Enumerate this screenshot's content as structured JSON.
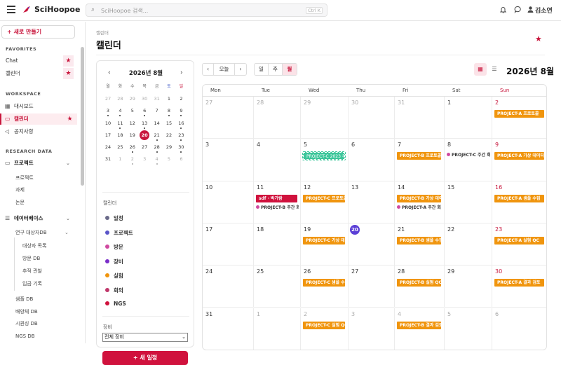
{
  "topbar": {
    "brand": "SciHoopoe",
    "search_placeholder": "SciHoopoe 검색...",
    "search_shortcut": "Ctrl K",
    "user_name": "김소연"
  },
  "sidebar": {
    "new_button": "+ 새로 만들기",
    "favorites_header": "FAVORITES",
    "favorites": [
      {
        "label": "Chat"
      },
      {
        "label": "캘린더"
      }
    ],
    "workspace_header": "WORKSPACE",
    "workspace": [
      {
        "label": "대시보드"
      },
      {
        "label": "캘린더"
      },
      {
        "label": "공지사항"
      }
    ],
    "research_header": "RESEARCH DATA",
    "project_group": "프로젝트",
    "project_items": [
      {
        "label": "프로젝트"
      },
      {
        "label": "과제"
      },
      {
        "label": "논문"
      }
    ],
    "db_group": "데이터베이스",
    "db_sub_group": "연구 대상자DB",
    "db_sub_items": [
      {
        "label": "대상자 목록"
      },
      {
        "label": "방문 DB"
      },
      {
        "label": "추적 관찰"
      },
      {
        "label": "입금 기록"
      }
    ],
    "db_items": [
      {
        "label": "샘플 DB"
      },
      {
        "label": "배양체 DB"
      },
      {
        "label": "시퀀싱 DB"
      },
      {
        "label": "NGS DB"
      }
    ]
  },
  "page": {
    "breadcrumb": "캘린더",
    "title": "캘린더"
  },
  "mini_calendar": {
    "title": "2026년 8월",
    "weekdays": [
      "월",
      "화",
      "수",
      "목",
      "금",
      "토",
      "일"
    ],
    "weeks": [
      [
        "27",
        "28",
        "29",
        "30",
        "31",
        "1",
        "2"
      ],
      [
        "3",
        "4",
        "5",
        "6",
        "7",
        "8",
        "9"
      ],
      [
        "10",
        "11",
        "12",
        "13",
        "14",
        "15",
        "16"
      ],
      [
        "17",
        "18",
        "19",
        "20",
        "21",
        "22",
        "23"
      ],
      [
        "24",
        "25",
        "26",
        "27",
        "28",
        "29",
        "30"
      ],
      [
        "31",
        "1",
        "2",
        "3",
        "4",
        "5",
        "6"
      ]
    ]
  },
  "calendars": {
    "label": "캘린더",
    "items": [
      {
        "label": "일정",
        "color": "#6b6b8a"
      },
      {
        "label": "프로젝트",
        "color": "#5a55c8"
      },
      {
        "label": "방문",
        "color": "#d04aa0"
      },
      {
        "label": "장비",
        "color": "#7a2ec9"
      },
      {
        "label": "실험",
        "color": "#f0950e"
      },
      {
        "label": "회의",
        "color": "#c0386b"
      },
      {
        "label": "NGS",
        "color": "#d0123d"
      }
    ]
  },
  "equipment": {
    "label": "장비",
    "selected": "전체 장비"
  },
  "new_event_button": "+ 새 일정",
  "toolbar": {
    "prev": "‹",
    "today": "오늘",
    "next": "›",
    "views": [
      "일",
      "주",
      "월"
    ],
    "title": "2026년 8월"
  },
  "month": {
    "weekdays": [
      "Mon",
      "Tue",
      "Wed",
      "Thu",
      "Fri",
      "Sat",
      "Sun"
    ],
    "weeks": [
      [
        {
          "d": "27"
        },
        {
          "d": "28"
        },
        {
          "d": "29"
        },
        {
          "d": "30"
        },
        {
          "d": "31"
        },
        {
          "d": "1"
        },
        {
          "d": "2",
          "events": [
            {
              "t": "PROJECT-A 프로토콜",
              "k": "orange"
            }
          ]
        }
      ],
      [
        {
          "d": "3"
        },
        {
          "d": "4"
        },
        {
          "d": "5",
          "events": [
            {
              "t": "PROJECT-C 2023 주간",
              "k": "dash"
            }
          ]
        },
        {
          "d": "6"
        },
        {
          "d": "7",
          "events": [
            {
              "t": "PROJECT-B 프로토콜",
              "k": "orange"
            }
          ]
        },
        {
          "d": "8",
          "events": [
            {
              "t": "PROJECT-C 주간 회",
              "k": "dot"
            }
          ]
        },
        {
          "d": "9",
          "events": [
            {
              "t": "PROJECT-A 가상 데이터",
              "k": "orange"
            }
          ]
        }
      ],
      [
        {
          "d": "10"
        },
        {
          "d": "11",
          "events": [
            {
              "t": "sdf · 박가람",
              "k": "red"
            },
            {
              "t": "PROJECT-B 주간 회",
              "k": "dot"
            }
          ]
        },
        {
          "d": "12",
          "events": [
            {
              "t": "PROJECT-C 프로토콜",
              "k": "orange"
            }
          ]
        },
        {
          "d": "13"
        },
        {
          "d": "14",
          "events": [
            {
              "t": "PROJECT-B 가상 데이터",
              "k": "orange"
            },
            {
              "t": "PROJECT-A 주간 회",
              "k": "dot"
            }
          ]
        },
        {
          "d": "15"
        },
        {
          "d": "16",
          "events": [
            {
              "t": "PROJECT-A 샘플 수집",
              "k": "orange"
            }
          ]
        }
      ],
      [
        {
          "d": "17"
        },
        {
          "d": "18"
        },
        {
          "d": "19",
          "events": [
            {
              "t": "PROJECT-C 가상 데이터",
              "k": "orange"
            }
          ]
        },
        {
          "d": "20"
        },
        {
          "d": "21",
          "events": [
            {
              "t": "PROJECT-B 샘플 수집",
              "k": "orange"
            }
          ]
        },
        {
          "d": "22"
        },
        {
          "d": "23",
          "events": [
            {
              "t": "PROJECT-A 실험 QC",
              "k": "orange"
            }
          ]
        }
      ],
      [
        {
          "d": "24"
        },
        {
          "d": "25"
        },
        {
          "d": "26",
          "events": [
            {
              "t": "PROJECT-C 샘플 수집",
              "k": "orange"
            }
          ]
        },
        {
          "d": "27"
        },
        {
          "d": "28",
          "events": [
            {
              "t": "PROJECT-B 실험 QC",
              "k": "orange"
            }
          ]
        },
        {
          "d": "29"
        },
        {
          "d": "30",
          "events": [
            {
              "t": "PROJECT-A 결과 검토",
              "k": "orange"
            }
          ]
        }
      ],
      [
        {
          "d": "31"
        },
        {
          "d": "1"
        },
        {
          "d": "2",
          "events": [
            {
              "t": "PROJECT-C 실험 QC",
              "k": "orange"
            }
          ]
        },
        {
          "d": "3"
        },
        {
          "d": "4",
          "events": [
            {
              "t": "PROJECT-B 결과 검토",
              "k": "orange"
            }
          ]
        },
        {
          "d": "5"
        },
        {
          "d": "6"
        }
      ]
    ]
  },
  "colors": {
    "accent": "#c8163c",
    "today": "#5b3fd6",
    "event": "#f0950e"
  }
}
